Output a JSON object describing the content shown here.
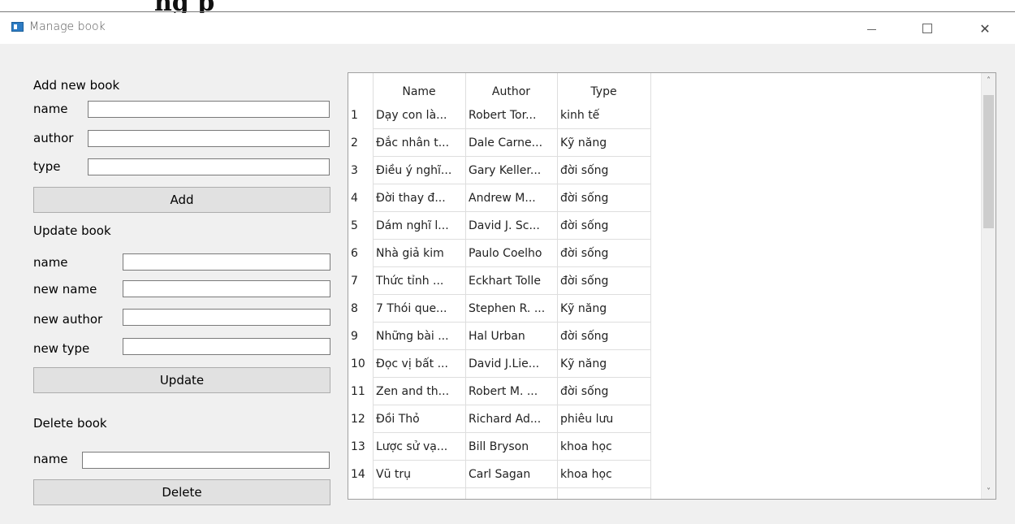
{
  "background_text": "ng p",
  "window": {
    "title": "Manage book"
  },
  "add_section": {
    "title": "Add new book",
    "name_label": "name",
    "author_label": "author",
    "type_label": "type",
    "button": "Add"
  },
  "update_section": {
    "title": "Update book",
    "name_label": "name",
    "new_name_label": "new name",
    "new_author_label": "new author",
    "new_type_label": "new type",
    "button": "Update"
  },
  "delete_section": {
    "title": "Delete book",
    "name_label": "name",
    "button": "Delete"
  },
  "table": {
    "columns": [
      "Name",
      "Author",
      "Type"
    ],
    "rows": [
      {
        "n": "1",
        "name": "Dạy con là...",
        "author": "Robert Tor...",
        "type": "kinh tế"
      },
      {
        "n": "2",
        "name": "Đắc nhân t...",
        "author": "Dale Carne...",
        "type": "Kỹ năng"
      },
      {
        "n": "3",
        "name": "Điều ý nghĩ...",
        "author": "Gary Keller...",
        "type": "đời sống"
      },
      {
        "n": "4",
        "name": "Đời thay đ...",
        "author": "Andrew M...",
        "type": "đời sống"
      },
      {
        "n": "5",
        "name": "Dám nghĩ l...",
        "author": "David J. Sc...",
        "type": "đời sống"
      },
      {
        "n": "6",
        "name": "Nhà giả kim",
        "author": "Paulo Coelho",
        "type": "đời sống"
      },
      {
        "n": "7",
        "name": "Thức tỉnh ...",
        "author": "Eckhart Tolle",
        "type": "đời sống"
      },
      {
        "n": "8",
        "name": "7 Thói que...",
        "author": "Stephen R. ...",
        "type": "Kỹ năng"
      },
      {
        "n": "9",
        "name": "Những bài ...",
        "author": "Hal Urban",
        "type": "đời sống"
      },
      {
        "n": "10",
        "name": "Đọc vị bất ...",
        "author": "David J.Lie...",
        "type": "Kỹ năng"
      },
      {
        "n": "11",
        "name": "Zen and th...",
        "author": "Robert M. ...",
        "type": "đời sống"
      },
      {
        "n": "12",
        "name": "Đồi Thỏ",
        "author": "Richard Ad...",
        "type": "phiêu lưu"
      },
      {
        "n": "13",
        "name": "Lược sử vạ...",
        "author": "Bill Bryson",
        "type": "khoa học"
      },
      {
        "n": "14",
        "name": "Vũ trụ",
        "author": "Carl Sagan",
        "type": "khoa học"
      }
    ]
  }
}
